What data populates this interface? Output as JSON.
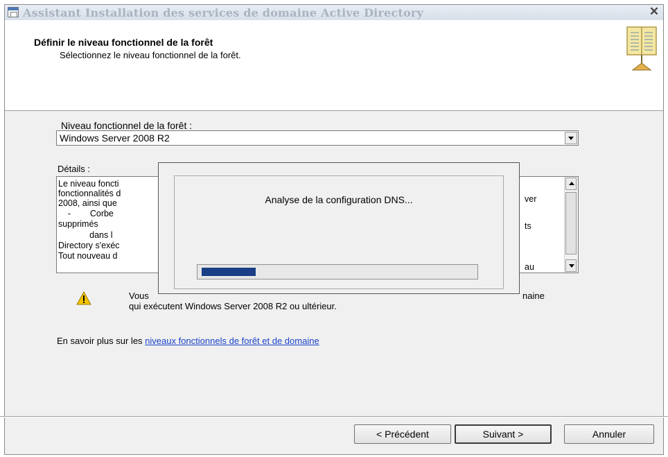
{
  "window": {
    "title": "Assistant Installation des services de domaine Active Directory",
    "close_glyph": "✕"
  },
  "header": {
    "title": "Définir le niveau fonctionnel de la forêt",
    "subtitle": "Sélectionnez le niveau fonctionnel de la forêt."
  },
  "forest_level": {
    "label": "Niveau fonctionnel de la forêt :",
    "selected": "Windows Server 2008 R2"
  },
  "details": {
    "label": "Détails :",
    "lines": [
      "Le niveau foncti",
      "fonctionnalités d",
      "2008, ainsi que",
      "    -        Corbe",
      "supprimés",
      "             dans l",
      "Directory s'exéc",
      "Tout nouveau d"
    ],
    "right_fragments": [
      "ver",
      "ts",
      "au"
    ]
  },
  "warning": {
    "icon": "warning-icon",
    "line1_start": "Vous",
    "line1_end": "naine",
    "line2": "qui exécutent Windows Server 2008 R2 ou ultérieur."
  },
  "learn_more": {
    "prefix": "En savoir plus sur les ",
    "link_text": "niveaux fonctionnels de forêt et de domaine"
  },
  "buttons": {
    "previous": "< Précédent",
    "next": "Suivant >",
    "cancel": "Annuler"
  },
  "progress_dialog": {
    "message": "Analyse de la configuration DNS...",
    "progress_fraction": 0.2
  },
  "colors": {
    "accent_link": "#1a44c9",
    "progress_fill": "#1a3f86",
    "warning_yellow": "#f5c400"
  }
}
